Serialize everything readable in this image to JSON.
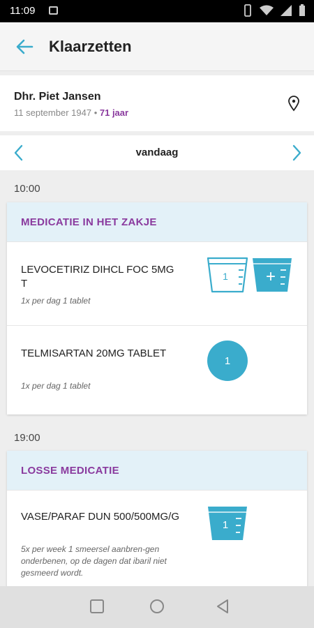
{
  "status_bar": {
    "time": "11:09"
  },
  "app_bar": {
    "title": "Klaarzetten"
  },
  "patient": {
    "name": "Dhr. Piet Jansen",
    "birthdate": "11 september 1947",
    "separator": "•",
    "age": "71 jaar"
  },
  "day_nav": {
    "label": "vandaag"
  },
  "schedule": [
    {
      "time": "10:00",
      "header": "MEDICATIE IN HET ZAKJE",
      "meds": [
        {
          "name": "LEVOCETIRIZ DIHCL FOC 5MG T",
          "dose": "1x per dag 1 tablet",
          "count": "1",
          "add": "+"
        },
        {
          "name": "TELMISARTAN 20MG TABLET",
          "dose": "1x per dag 1 tablet",
          "count": "1"
        }
      ]
    },
    {
      "time": "19:00",
      "header": "LOSSE MEDICATIE",
      "meds": [
        {
          "name": "VASE/PARAF DUN 500/500MG/G",
          "dose": "5x per week 1 smeersel aanbren-gen onderbenen, op de dagen dat ibaril niet gesmeerd wordt.",
          "count": "1"
        }
      ]
    }
  ],
  "colors": {
    "accent": "#3aaccc",
    "purple": "#8a3a9e",
    "header_bg": "#e3f1f8"
  }
}
